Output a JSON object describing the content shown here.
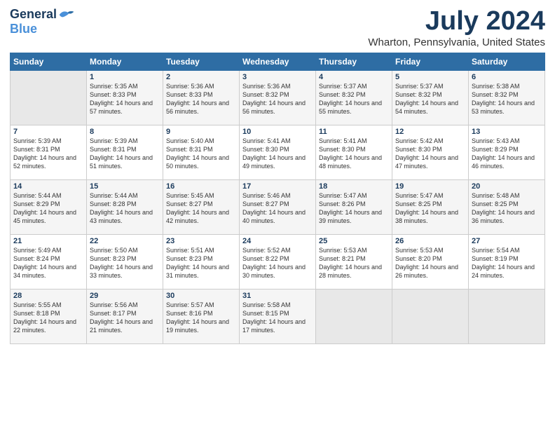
{
  "header": {
    "logo_general": "General",
    "logo_blue": "Blue",
    "month_title": "July 2024",
    "location": "Wharton, Pennsylvania, United States"
  },
  "days_of_week": [
    "Sunday",
    "Monday",
    "Tuesday",
    "Wednesday",
    "Thursday",
    "Friday",
    "Saturday"
  ],
  "weeks": [
    [
      {
        "day": "",
        "empty": true
      },
      {
        "day": "1",
        "sunrise": "Sunrise: 5:35 AM",
        "sunset": "Sunset: 8:33 PM",
        "daylight": "Daylight: 14 hours and 57 minutes."
      },
      {
        "day": "2",
        "sunrise": "Sunrise: 5:36 AM",
        "sunset": "Sunset: 8:33 PM",
        "daylight": "Daylight: 14 hours and 56 minutes."
      },
      {
        "day": "3",
        "sunrise": "Sunrise: 5:36 AM",
        "sunset": "Sunset: 8:32 PM",
        "daylight": "Daylight: 14 hours and 56 minutes."
      },
      {
        "day": "4",
        "sunrise": "Sunrise: 5:37 AM",
        "sunset": "Sunset: 8:32 PM",
        "daylight": "Daylight: 14 hours and 55 minutes."
      },
      {
        "day": "5",
        "sunrise": "Sunrise: 5:37 AM",
        "sunset": "Sunset: 8:32 PM",
        "daylight": "Daylight: 14 hours and 54 minutes."
      },
      {
        "day": "6",
        "sunrise": "Sunrise: 5:38 AM",
        "sunset": "Sunset: 8:32 PM",
        "daylight": "Daylight: 14 hours and 53 minutes."
      }
    ],
    [
      {
        "day": "7",
        "sunrise": "Sunrise: 5:39 AM",
        "sunset": "Sunset: 8:31 PM",
        "daylight": "Daylight: 14 hours and 52 minutes."
      },
      {
        "day": "8",
        "sunrise": "Sunrise: 5:39 AM",
        "sunset": "Sunset: 8:31 PM",
        "daylight": "Daylight: 14 hours and 51 minutes."
      },
      {
        "day": "9",
        "sunrise": "Sunrise: 5:40 AM",
        "sunset": "Sunset: 8:31 PM",
        "daylight": "Daylight: 14 hours and 50 minutes."
      },
      {
        "day": "10",
        "sunrise": "Sunrise: 5:41 AM",
        "sunset": "Sunset: 8:30 PM",
        "daylight": "Daylight: 14 hours and 49 minutes."
      },
      {
        "day": "11",
        "sunrise": "Sunrise: 5:41 AM",
        "sunset": "Sunset: 8:30 PM",
        "daylight": "Daylight: 14 hours and 48 minutes."
      },
      {
        "day": "12",
        "sunrise": "Sunrise: 5:42 AM",
        "sunset": "Sunset: 8:30 PM",
        "daylight": "Daylight: 14 hours and 47 minutes."
      },
      {
        "day": "13",
        "sunrise": "Sunrise: 5:43 AM",
        "sunset": "Sunset: 8:29 PM",
        "daylight": "Daylight: 14 hours and 46 minutes."
      }
    ],
    [
      {
        "day": "14",
        "sunrise": "Sunrise: 5:44 AM",
        "sunset": "Sunset: 8:29 PM",
        "daylight": "Daylight: 14 hours and 45 minutes."
      },
      {
        "day": "15",
        "sunrise": "Sunrise: 5:44 AM",
        "sunset": "Sunset: 8:28 PM",
        "daylight": "Daylight: 14 hours and 43 minutes."
      },
      {
        "day": "16",
        "sunrise": "Sunrise: 5:45 AM",
        "sunset": "Sunset: 8:27 PM",
        "daylight": "Daylight: 14 hours and 42 minutes."
      },
      {
        "day": "17",
        "sunrise": "Sunrise: 5:46 AM",
        "sunset": "Sunset: 8:27 PM",
        "daylight": "Daylight: 14 hours and 40 minutes."
      },
      {
        "day": "18",
        "sunrise": "Sunrise: 5:47 AM",
        "sunset": "Sunset: 8:26 PM",
        "daylight": "Daylight: 14 hours and 39 minutes."
      },
      {
        "day": "19",
        "sunrise": "Sunrise: 5:47 AM",
        "sunset": "Sunset: 8:25 PM",
        "daylight": "Daylight: 14 hours and 38 minutes."
      },
      {
        "day": "20",
        "sunrise": "Sunrise: 5:48 AM",
        "sunset": "Sunset: 8:25 PM",
        "daylight": "Daylight: 14 hours and 36 minutes."
      }
    ],
    [
      {
        "day": "21",
        "sunrise": "Sunrise: 5:49 AM",
        "sunset": "Sunset: 8:24 PM",
        "daylight": "Daylight: 14 hours and 34 minutes."
      },
      {
        "day": "22",
        "sunrise": "Sunrise: 5:50 AM",
        "sunset": "Sunset: 8:23 PM",
        "daylight": "Daylight: 14 hours and 33 minutes."
      },
      {
        "day": "23",
        "sunrise": "Sunrise: 5:51 AM",
        "sunset": "Sunset: 8:23 PM",
        "daylight": "Daylight: 14 hours and 31 minutes."
      },
      {
        "day": "24",
        "sunrise": "Sunrise: 5:52 AM",
        "sunset": "Sunset: 8:22 PM",
        "daylight": "Daylight: 14 hours and 30 minutes."
      },
      {
        "day": "25",
        "sunrise": "Sunrise: 5:53 AM",
        "sunset": "Sunset: 8:21 PM",
        "daylight": "Daylight: 14 hours and 28 minutes."
      },
      {
        "day": "26",
        "sunrise": "Sunrise: 5:53 AM",
        "sunset": "Sunset: 8:20 PM",
        "daylight": "Daylight: 14 hours and 26 minutes."
      },
      {
        "day": "27",
        "sunrise": "Sunrise: 5:54 AM",
        "sunset": "Sunset: 8:19 PM",
        "daylight": "Daylight: 14 hours and 24 minutes."
      }
    ],
    [
      {
        "day": "28",
        "sunrise": "Sunrise: 5:55 AM",
        "sunset": "Sunset: 8:18 PM",
        "daylight": "Daylight: 14 hours and 22 minutes."
      },
      {
        "day": "29",
        "sunrise": "Sunrise: 5:56 AM",
        "sunset": "Sunset: 8:17 PM",
        "daylight": "Daylight: 14 hours and 21 minutes."
      },
      {
        "day": "30",
        "sunrise": "Sunrise: 5:57 AM",
        "sunset": "Sunset: 8:16 PM",
        "daylight": "Daylight: 14 hours and 19 minutes."
      },
      {
        "day": "31",
        "sunrise": "Sunrise: 5:58 AM",
        "sunset": "Sunset: 8:15 PM",
        "daylight": "Daylight: 14 hours and 17 minutes."
      },
      {
        "day": "",
        "empty": true
      },
      {
        "day": "",
        "empty": true
      },
      {
        "day": "",
        "empty": true
      }
    ]
  ]
}
